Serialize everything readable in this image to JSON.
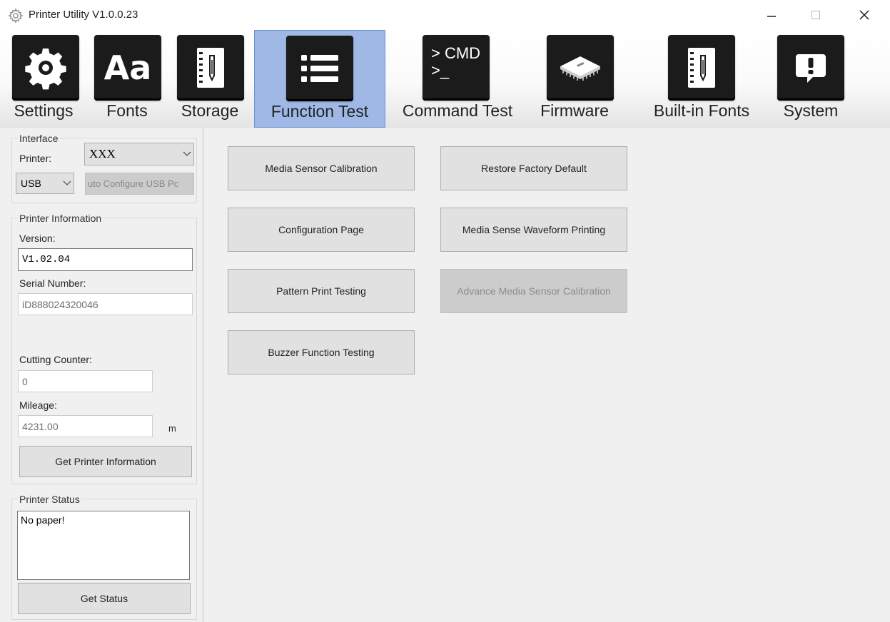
{
  "window": {
    "title": "Printer Utility  V1.0.0.23",
    "minimize": "—",
    "maximize": "□",
    "close": "✕"
  },
  "toolbar": {
    "tabs": [
      {
        "label": "Settings",
        "icon": "gear-icon"
      },
      {
        "label": "Fonts",
        "icon": "font-icon",
        "glyph": "Aa"
      },
      {
        "label": "Storage",
        "icon": "storage-icon"
      },
      {
        "label": "Function Test",
        "icon": "list-icon",
        "active": true
      },
      {
        "label": "Command Test",
        "icon": "command-icon",
        "line1": "> CMD",
        "line2": ">_"
      },
      {
        "label": "Firmware",
        "icon": "chip-icon"
      },
      {
        "label": "Built-in Fonts",
        "icon": "builtin-fonts-icon"
      },
      {
        "label": "System",
        "icon": "alert-icon",
        "glyph": "!"
      }
    ]
  },
  "interface": {
    "title": "Interface",
    "printer_label": "Printer:",
    "printer_value": "XXX",
    "port_value": "USB",
    "auto_config_label": "uto Configure USB Pc"
  },
  "printer_info": {
    "title": "Printer Information",
    "version_label": "Version:",
    "version_value": "V1.02.04",
    "serial_label": "Serial Number:",
    "serial_value": "iD888024320046",
    "cutting_label": "Cutting Counter:",
    "cutting_value": "0",
    "mileage_label": "Mileage:",
    "mileage_value": "4231.00",
    "mileage_unit": "m",
    "get_info_label": "Get Printer Information"
  },
  "printer_status": {
    "title": "Printer Status",
    "status_text": "No paper!",
    "get_status_label": "Get Status"
  },
  "function_test": {
    "left_buttons": [
      "Media Sensor Calibration",
      "Configuration Page",
      "Pattern Print Testing",
      "Buzzer Function Testing"
    ],
    "right_buttons": [
      {
        "label": "Restore Factory Default",
        "enabled": true
      },
      {
        "label": "Media Sense Waveform Printing",
        "enabled": true
      },
      {
        "label": "Advance Media Sensor Calibration",
        "enabled": false
      }
    ]
  }
}
